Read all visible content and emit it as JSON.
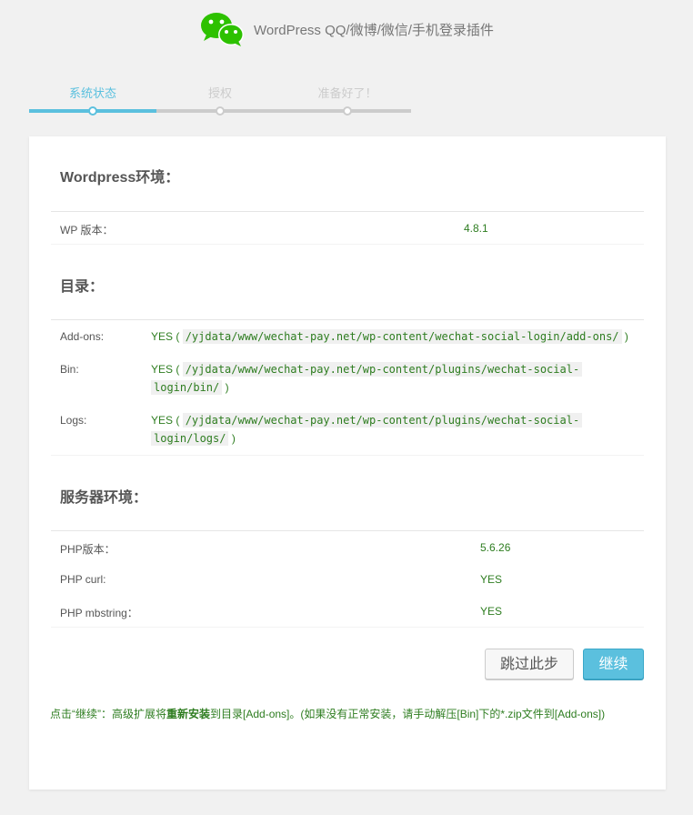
{
  "header": {
    "title": "WordPress QQ/微博/微信/手机登录插件",
    "logo_icon": "wechat-logo-icon",
    "brand_color": "#2dc100"
  },
  "steps": [
    {
      "label": "系统状态",
      "active": true
    },
    {
      "label": "授权",
      "active": false
    },
    {
      "label": "准备好了！",
      "active": false
    }
  ],
  "accent_color": "#5bc0de",
  "sections": {
    "wordpress": {
      "title": "Wordpress环境：",
      "rows": [
        {
          "label": "WP 版本：",
          "value": "4.8.1"
        }
      ]
    },
    "directories": {
      "title": "目录：",
      "rows": [
        {
          "label": "Add-ons:",
          "status": "YES",
          "path_line1": "/yjdata/www/wechat-pay.net/wp-content/wechat-social-login/add-ons/",
          "path_line2": ""
        },
        {
          "label": "Bin:",
          "status": "YES",
          "path_line1": "/yjdata/www/wechat-pay.net/wp-content/plugins/wechat-social-",
          "path_line2": "login/bin/"
        },
        {
          "label": "Logs:",
          "status": "YES",
          "path_line1": "/yjdata/www/wechat-pay.net/wp-content/plugins/wechat-social-",
          "path_line2": "login/logs/"
        }
      ]
    },
    "server": {
      "title": "服务器环境：",
      "rows": [
        {
          "label": "PHP版本：",
          "value": "5.6.26"
        },
        {
          "label": "PHP curl:",
          "value": "YES"
        },
        {
          "label": "PHP mbstring：",
          "value": "YES"
        }
      ]
    }
  },
  "actions": {
    "skip_label": "跳过此步",
    "continue_label": "继续"
  },
  "note": {
    "part1": "点击“继续”：高级扩展将",
    "bold": "重新安装",
    "part2": "到目录[Add-ons]。(如果没有正常安装，请手动解压[Bin]下的*.zip文件到[Add-ons])"
  },
  "paren_open": "(",
  "paren_close": ")"
}
